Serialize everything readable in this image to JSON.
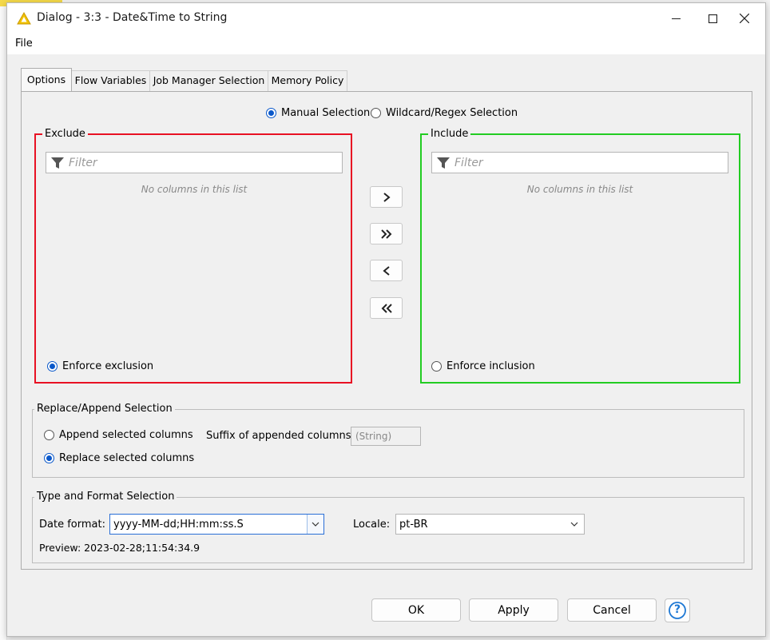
{
  "window": {
    "title": "Dialog - 3:3 - Date&Time to String",
    "minimize_glyph": "—",
    "maximize_glyph": "☐",
    "close_glyph": "✕"
  },
  "menu": {
    "file": "File"
  },
  "tabs": [
    {
      "label": "Options",
      "active": true
    },
    {
      "label": "Flow Variables",
      "active": false
    },
    {
      "label": "Job Manager Selection",
      "active": false
    },
    {
      "label": "Memory Policy",
      "active": false
    }
  ],
  "selection_mode": {
    "manual": "Manual Selection",
    "wildcard": "Wildcard/Regex Selection",
    "selected": "manual"
  },
  "exclude": {
    "legend": "Exclude",
    "filter_placeholder": "Filter",
    "empty_message": "No columns in this list",
    "enforce_label": "Enforce exclusion",
    "enforce_checked": true,
    "border_color": "#e81123"
  },
  "include": {
    "legend": "Include",
    "filter_placeholder": "Filter",
    "empty_message": "No columns in this list",
    "enforce_label": "Enforce inclusion",
    "enforce_checked": false,
    "border_color": "#22cc22"
  },
  "transfer_buttons": {
    "add": "›",
    "add_all": "»",
    "remove": "‹",
    "remove_all": "«"
  },
  "replace_append": {
    "legend": "Replace/Append Selection",
    "append_label": "Append selected columns",
    "replace_label": "Replace selected columns",
    "selected": "replace",
    "suffix_label": "Suffix of appended columns:",
    "suffix_value": "(String)"
  },
  "type_format": {
    "legend": "Type and Format Selection",
    "date_format_label": "Date format:",
    "date_format_value": "yyyy-MM-dd;HH:mm:ss.S",
    "locale_label": "Locale:",
    "locale_value": "pt-BR",
    "preview": "Preview: 2023-02-28;11:54:34.9"
  },
  "footer": {
    "ok": "OK",
    "apply": "Apply",
    "cancel": "Cancel",
    "help": "?"
  },
  "colors": {
    "accent": "#0a58ca",
    "warning_icon": "#f2c200"
  }
}
